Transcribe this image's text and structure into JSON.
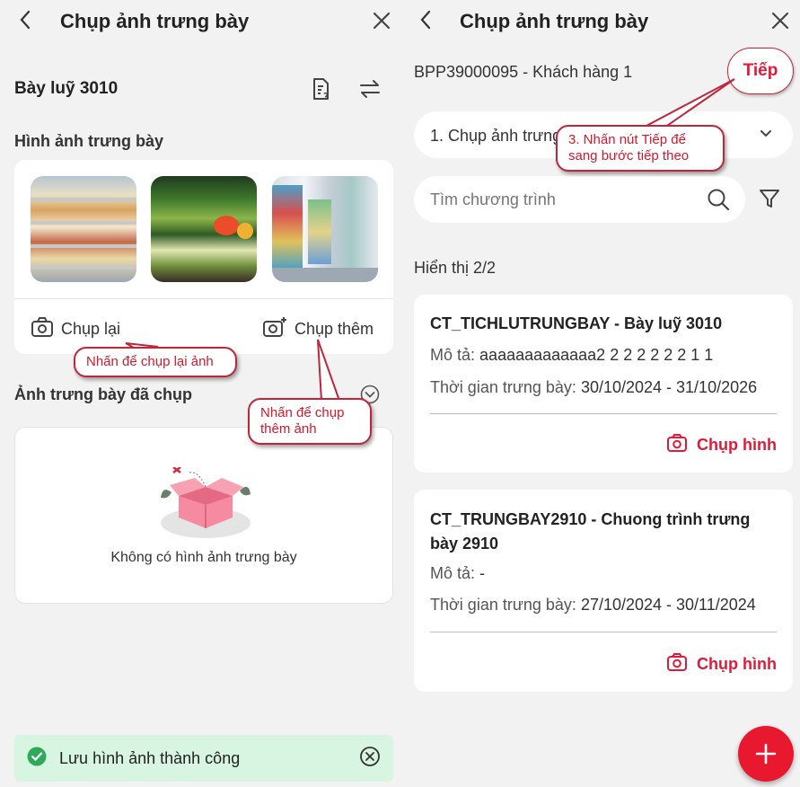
{
  "left": {
    "header": {
      "title": "Chụp ảnh trưng bày"
    },
    "section_title": "Bày luỹ 3010",
    "gallery": {
      "heading": "Hình ảnh trưng bày",
      "retake_label": "Chụp lại",
      "add_more_label": "Chụp thêm"
    },
    "captured": {
      "heading": "Ảnh trưng bày đã chụp",
      "empty_text": "Không có hình ảnh trưng bày"
    },
    "callouts": {
      "retake": "Nhấn để chụp lại ảnh",
      "add_more": "Nhấn để chụp thêm ảnh"
    },
    "toast": {
      "message": "Lưu hình ảnh thành công"
    }
  },
  "right": {
    "header": {
      "title": "Chụp ảnh trưng bày"
    },
    "customer": "BPP39000095 - Khách hàng 1",
    "next_label": "Tiếp",
    "step_select": {
      "value": "1. Chụp ảnh trưng"
    },
    "search": {
      "placeholder": "Tìm chương trình"
    },
    "count_text": "Hiển thị 2/2",
    "callout": "3. Nhấn nút Tiếp để sang bước tiếp theo",
    "programs": [
      {
        "title": "CT_TICHLUTRUNGBAY - Bày luỹ 3010",
        "desc_label": "Mô tả:",
        "desc_value": "aaaaaaaaaaaaa2 2 2 2 2 2 2 1 1",
        "time_label": "Thời gian trưng bày:",
        "time_value": "30/10/2024 - 31/10/2026",
        "action": "Chụp hình"
      },
      {
        "title": "CT_TRUNGBAY2910 - Chuong trình trưng bày 2910",
        "desc_label": "Mô tả:",
        "desc_value": "-",
        "time_label": "Thời gian trưng bày:",
        "time_value": "27/10/2024 - 30/11/2024",
        "action": "Chụp hình"
      }
    ]
  },
  "colors": {
    "accent": "#e01b38",
    "success": "#2faa5a",
    "toast_bg": "#d7f5e1"
  }
}
